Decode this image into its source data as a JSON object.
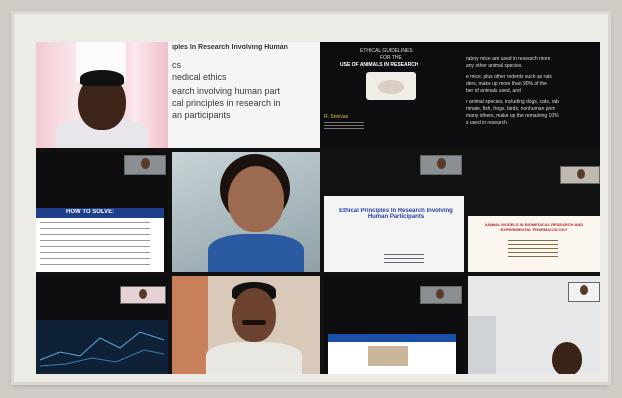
{
  "gallery": {
    "slide_main_title_strip": "iples In Research Involving Human",
    "slide_main_lines": [
      "cs",
      "nedical ethics",
      "earch involving human part",
      "cal principles in research in",
      "an participants"
    ],
    "slide_animals_header": "ETHICAL GUIDELINES",
    "slide_animals_sub": "FOR THE",
    "slide_animals_title": "USE OF ANIMALS IN RESEARCH",
    "slide_animals_author": "R. Srinivas",
    "slide_right_lines": [
      "ratory mice are used in research more",
      "any other animal species.",
      "e mice, plus other rodents such as rats",
      "ders, make up more than 90% of the",
      "ber of animals used, and",
      "r animal species, including dogs, cats, rab",
      "rimate, fish, frogs, birds, nonhuman prim",
      "many others, make up the remaining 10%",
      "s used in research."
    ],
    "slide_how_title": "HOW TO SOLVE:",
    "slide_ethical_title": "Ethical Principles In Research Involving Human Participants",
    "slide_models_title": "ANIMAL MODELS IN BIOMEDICAL RESEARCH AND EXPERIMENTAL PHARMACOLOGY"
  },
  "colors": {
    "frame": "#ecebe6",
    "outer": "#cfcdc6",
    "tile_dark": "#0d0d0f",
    "link_blue": "#1c4fa8",
    "red_title": "#b4242a"
  }
}
